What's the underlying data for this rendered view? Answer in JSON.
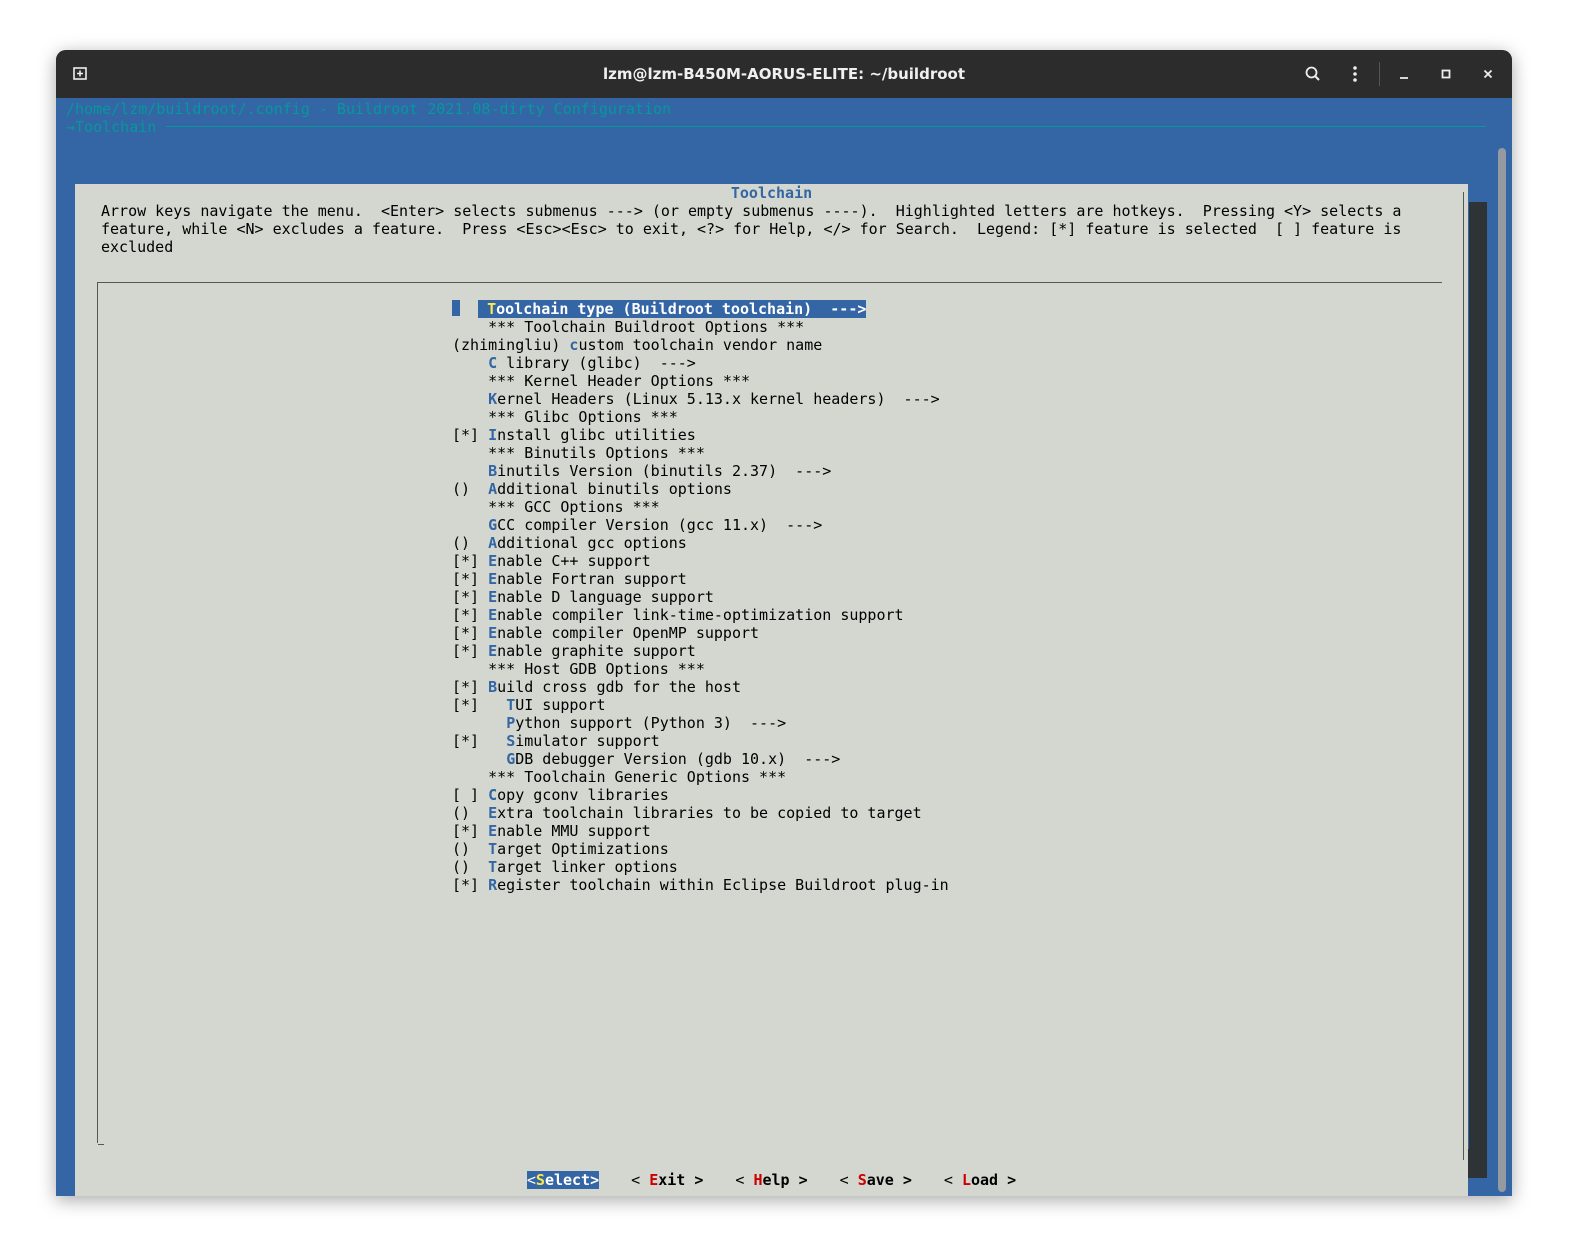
{
  "window": {
    "title": "lzm@lzm-B450M-AORUS-ELITE: ~/buildroot"
  },
  "terminal": {
    "header_path": "/home/lzm/buildroot/.config - Buildroot 2021.08-dirty Configuration",
    "header_breadcrumb": "→Toolchain"
  },
  "dialog": {
    "title": "Toolchain",
    "help_text": "Arrow keys navigate the menu.  <Enter> selects submenus ---> (or empty submenus ----).  Highlighted letters are hotkeys.  Pressing <Y> selects a\nfeature, while <N> excludes a feature.  Press <Esc><Esc> to exit, <?> for Help, </> for Search.  Legend: [*] feature is selected  [ ] feature is\nexcluded"
  },
  "menu": {
    "items": [
      {
        "prefix": "    ",
        "hotkey": "T",
        "rest": "oolchain type (Buildroot toolchain)  --->",
        "selected": true
      },
      {
        "prefix": "    ",
        "hotkey": "",
        "rest": "*** Toolchain Buildroot Options ***"
      },
      {
        "prefix": "(zhimingliu) ",
        "hotkey": "c",
        "rest": "ustom toolchain vendor name"
      },
      {
        "prefix": "    ",
        "hotkey": "C",
        "rest": " library (glibc)  --->"
      },
      {
        "prefix": "    ",
        "hotkey": "",
        "rest": "*** Kernel Header Options ***"
      },
      {
        "prefix": "    ",
        "hotkey": "K",
        "rest": "ernel Headers (Linux 5.13.x kernel headers)  --->"
      },
      {
        "prefix": "    ",
        "hotkey": "",
        "rest": "*** Glibc Options ***"
      },
      {
        "prefix": "[*] ",
        "hotkey": "I",
        "rest": "nstall glibc utilities"
      },
      {
        "prefix": "    ",
        "hotkey": "",
        "rest": "*** Binutils Options ***"
      },
      {
        "prefix": "    ",
        "hotkey": "B",
        "rest": "inutils Version (binutils 2.37)  --->"
      },
      {
        "prefix": "()  ",
        "hotkey": "A",
        "rest": "dditional binutils options"
      },
      {
        "prefix": "    ",
        "hotkey": "",
        "rest": "*** GCC Options ***"
      },
      {
        "prefix": "    ",
        "hotkey": "G",
        "rest": "CC compiler Version (gcc 11.x)  --->"
      },
      {
        "prefix": "()  ",
        "hotkey": "A",
        "rest": "dditional gcc options"
      },
      {
        "prefix": "[*] ",
        "hotkey": "E",
        "rest": "nable C++ support"
      },
      {
        "prefix": "[*] ",
        "hotkey": "E",
        "rest": "nable Fortran support"
      },
      {
        "prefix": "[*] ",
        "hotkey": "E",
        "rest": "nable D language support"
      },
      {
        "prefix": "[*] ",
        "hotkey": "E",
        "rest": "nable compiler link-time-optimization support"
      },
      {
        "prefix": "[*] ",
        "hotkey": "E",
        "rest": "nable compiler OpenMP support"
      },
      {
        "prefix": "[*] ",
        "hotkey": "E",
        "rest": "nable graphite support"
      },
      {
        "prefix": "    ",
        "hotkey": "",
        "rest": "*** Host GDB Options ***"
      },
      {
        "prefix": "[*] ",
        "hotkey": "B",
        "rest": "uild cross gdb for the host"
      },
      {
        "prefix": "[*]   ",
        "hotkey": "T",
        "rest": "UI support"
      },
      {
        "prefix": "      ",
        "hotkey": "P",
        "rest": "ython support (Python 3)  --->"
      },
      {
        "prefix": "[*]   ",
        "hotkey": "S",
        "rest": "imulator support"
      },
      {
        "prefix": "      ",
        "hotkey": "G",
        "rest": "DB debugger Version (gdb 10.x)  --->"
      },
      {
        "prefix": "    ",
        "hotkey": "",
        "rest": "*** Toolchain Generic Options ***"
      },
      {
        "prefix": "[ ] ",
        "hotkey": "C",
        "rest": "opy gconv libraries"
      },
      {
        "prefix": "()  ",
        "hotkey": "E",
        "rest": "xtra toolchain libraries to be copied to target"
      },
      {
        "prefix": "[*] ",
        "hotkey": "E",
        "rest": "nable MMU support"
      },
      {
        "prefix": "()  ",
        "hotkey": "T",
        "rest": "arget Optimizations"
      },
      {
        "prefix": "()  ",
        "hotkey": "T",
        "rest": "arget linker options"
      },
      {
        "prefix": "[*] ",
        "hotkey": "R",
        "rest": "egister toolchain within Eclipse Buildroot plug-in"
      }
    ]
  },
  "buttons": [
    {
      "pre": "<",
      "hotkey": "S",
      "post": "elect>",
      "active": true
    },
    {
      "pre": "< ",
      "hotkey": "E",
      "post": "xit >",
      "active": false
    },
    {
      "pre": "< ",
      "hotkey": "H",
      "post": "elp >",
      "active": false
    },
    {
      "pre": "< ",
      "hotkey": "S",
      "post": "ave >",
      "active": false
    },
    {
      "pre": "< ",
      "hotkey": "L",
      "post": "oad >",
      "active": false
    }
  ]
}
